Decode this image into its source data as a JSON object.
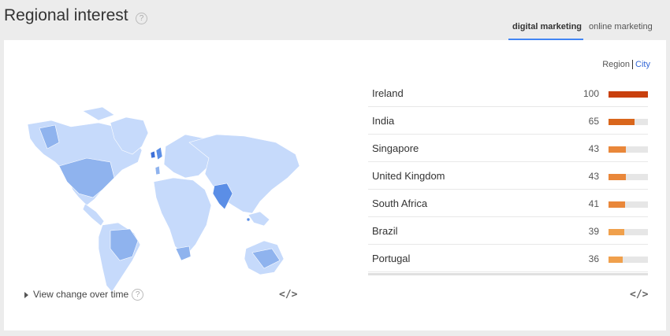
{
  "header": {
    "title": "Regional interest",
    "help": "?"
  },
  "tabs": [
    {
      "label": "digital marketing",
      "active": true
    },
    {
      "label": "online marketing",
      "active": false
    }
  ],
  "toggle": {
    "region_label": "Region",
    "city_label": "City"
  },
  "view_change": {
    "label": "View change over time",
    "help": "?"
  },
  "embed_icon_text": "</>",
  "regions": [
    {
      "name": "Ireland",
      "value": 100,
      "color": "#c9400e"
    },
    {
      "name": "India",
      "value": 65,
      "color": "#d9661c"
    },
    {
      "name": "Singapore",
      "value": 43,
      "color": "#e9873a"
    },
    {
      "name": "United Kingdom",
      "value": 43,
      "color": "#e9873a"
    },
    {
      "name": "South Africa",
      "value": 41,
      "color": "#e9873a"
    },
    {
      "name": "Brazil",
      "value": 39,
      "color": "#f0a04c"
    },
    {
      "name": "Portugal",
      "value": 36,
      "color": "#f0a04c"
    }
  ],
  "colors": {
    "map_land": "#c6dafb",
    "map_mid": "#8fb3ee",
    "map_high": "#5b8ee6",
    "accent_blue": "#4285f4"
  }
}
